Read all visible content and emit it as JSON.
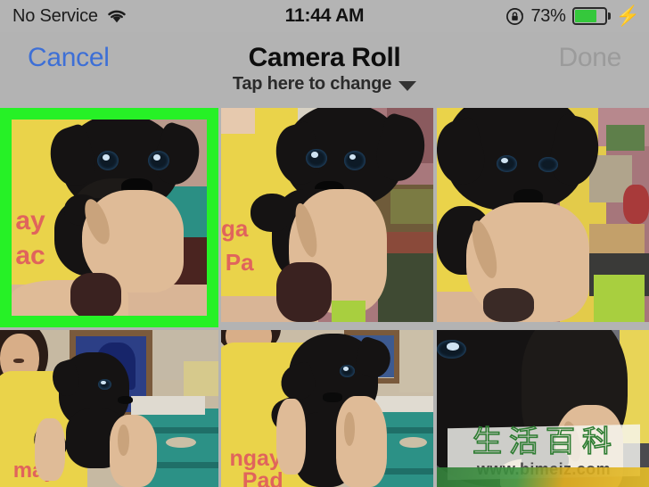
{
  "status_bar": {
    "carrier": "No Service",
    "wifi_icon": "wifi-icon",
    "time": "11:44 AM",
    "rotation_lock_icon": "rotation-lock-icon",
    "battery_percent": "73%",
    "battery_level": 73,
    "battery_color": "#35c83c",
    "charging_icon": "lightning-bolt-icon",
    "background_color": "#b4b4b4"
  },
  "nav_bar": {
    "cancel_label": "Cancel",
    "cancel_color": "#3d6fd6",
    "title": "Camera Roll",
    "subtitle": "Tap here to change",
    "caret_icon": "chevron-down-icon",
    "done_label": "Done",
    "done_color": "#9b9b9b",
    "done_enabled": false
  },
  "grid": {
    "columns": 3,
    "rows": 2,
    "selection_color": "#26f126",
    "selected_index": 0,
    "photos": [
      {
        "index": 0,
        "alt": "Black puppy held up close by person in yellow shirt with pink lettering",
        "selected": true
      },
      {
        "index": 1,
        "alt": "Black puppy held in hand, yellow shirt, gift boxes in background",
        "selected": false
      },
      {
        "index": 2,
        "alt": "Close view of black puppy held in hand against yellow shirt and boxes",
        "selected": false
      },
      {
        "index": 3,
        "alt": "Person smiling holding black puppy, blue framed picture and teal dresser behind",
        "selected": false
      },
      {
        "index": 4,
        "alt": "Person in yellow shirt reading ngay Pa holding black puppy, teal dresser behind",
        "selected": false
      },
      {
        "index": 5,
        "alt": "Extreme close-up of black puppy head held by hand",
        "selected": false
      }
    ]
  },
  "watermark": {
    "cjk_text": "生活百科",
    "url_text": "www.bimeiz.com",
    "stroke_color": "#2e7d32"
  },
  "shirt_text": {
    "photo_0": [
      "ay",
      "ac"
    ],
    "photo_1": [
      "ga",
      "Pa"
    ],
    "photo_3": [
      "may"
    ],
    "photo_4": [
      "ngay",
      "Pad"
    ]
  }
}
